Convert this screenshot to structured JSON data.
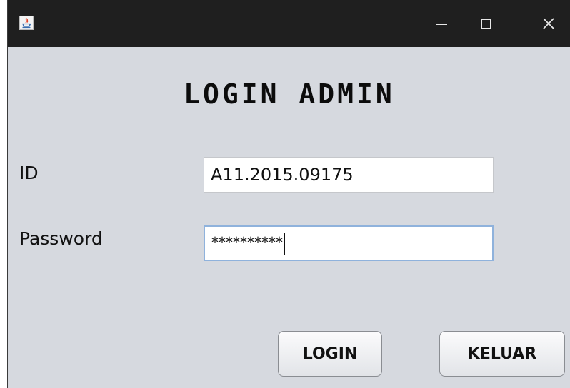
{
  "window": {
    "app_icon": "java-icon",
    "controls": [
      "minimize-icon",
      "maximize-icon",
      "close-icon"
    ]
  },
  "form": {
    "heading": "LOGIN ADMIN",
    "id_label": "ID",
    "id_value": "A11.2015.09175",
    "password_label": "Password",
    "password_value": "**********"
  },
  "buttons": {
    "login_label": "LOGIN",
    "keluar_label": "KELUAR"
  },
  "colors": {
    "titlebar": "#1f1f1f",
    "window_bg": "#d6d9df",
    "focus_border": "#8fb2dc"
  }
}
